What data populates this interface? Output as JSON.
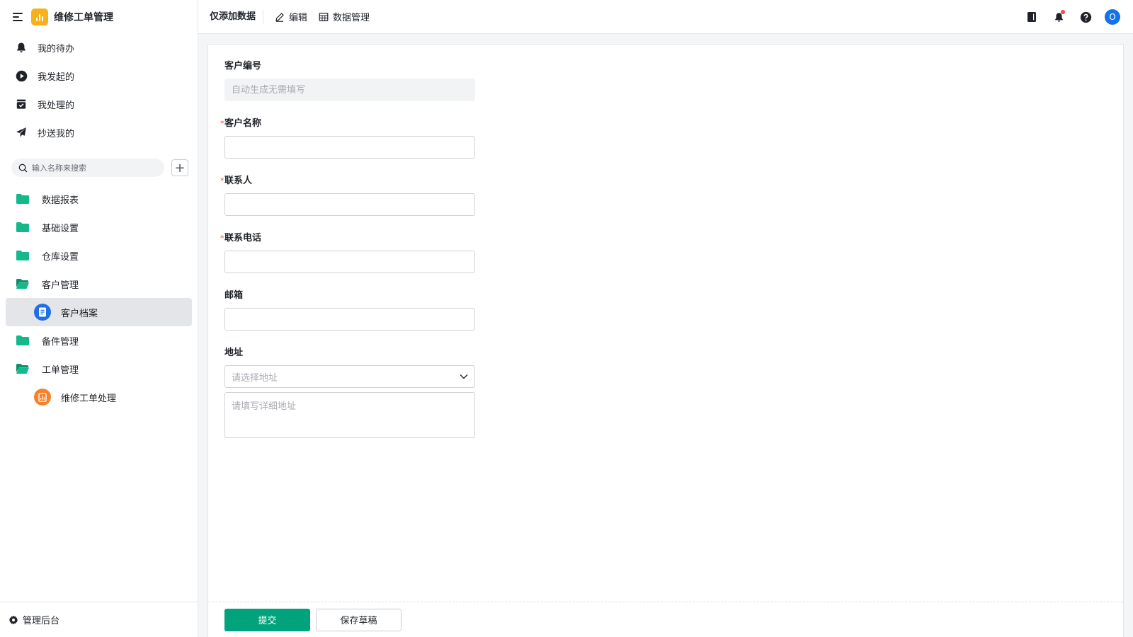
{
  "app": {
    "title": "维修工单管理"
  },
  "nav": [
    {
      "label": "我的待办",
      "icon": "bell-icon"
    },
    {
      "label": "我发起的",
      "icon": "play-circle-icon"
    },
    {
      "label": "我处理的",
      "icon": "inbox-check-icon"
    },
    {
      "label": "抄送我的",
      "icon": "paper-plane-icon"
    }
  ],
  "search": {
    "placeholder": "输入名称来搜索",
    "add_label": "+"
  },
  "tree": [
    {
      "label": "数据报表",
      "type": "folder"
    },
    {
      "label": "基础设置",
      "type": "folder"
    },
    {
      "label": "仓库设置",
      "type": "folder"
    },
    {
      "label": "客户管理",
      "type": "folder-open"
    },
    {
      "label": "客户档案",
      "type": "page",
      "active": true
    },
    {
      "label": "备件管理",
      "type": "folder"
    },
    {
      "label": "工单管理",
      "type": "folder-open"
    },
    {
      "label": "维修工单处理",
      "type": "page"
    }
  ],
  "footer": {
    "label": "管理后台"
  },
  "topbar": {
    "title": "仅添加数据",
    "edit_label": "编辑",
    "data_label": "数据管理",
    "avatar": "O"
  },
  "form": {
    "customer_no": {
      "label": "客户编号",
      "placeholder": "自动生成无需填写"
    },
    "customer_name": {
      "label": "客户名称",
      "required": "*"
    },
    "contact": {
      "label": "联系人",
      "required": "*"
    },
    "phone": {
      "label": "联系电话",
      "required": "*"
    },
    "email": {
      "label": "邮箱"
    },
    "address": {
      "label": "地址",
      "select_placeholder": "请选择地址",
      "detail_placeholder": "请填写详细地址"
    },
    "submit_label": "提交",
    "draft_label": "保存草稿"
  },
  "colors": {
    "primary": "#00a37b",
    "folder": "#14b88a",
    "logo": "#f7b21a",
    "page_blue": "#1f6fe5",
    "page_orange": "#f5812a",
    "avatar": "#1473e6"
  }
}
